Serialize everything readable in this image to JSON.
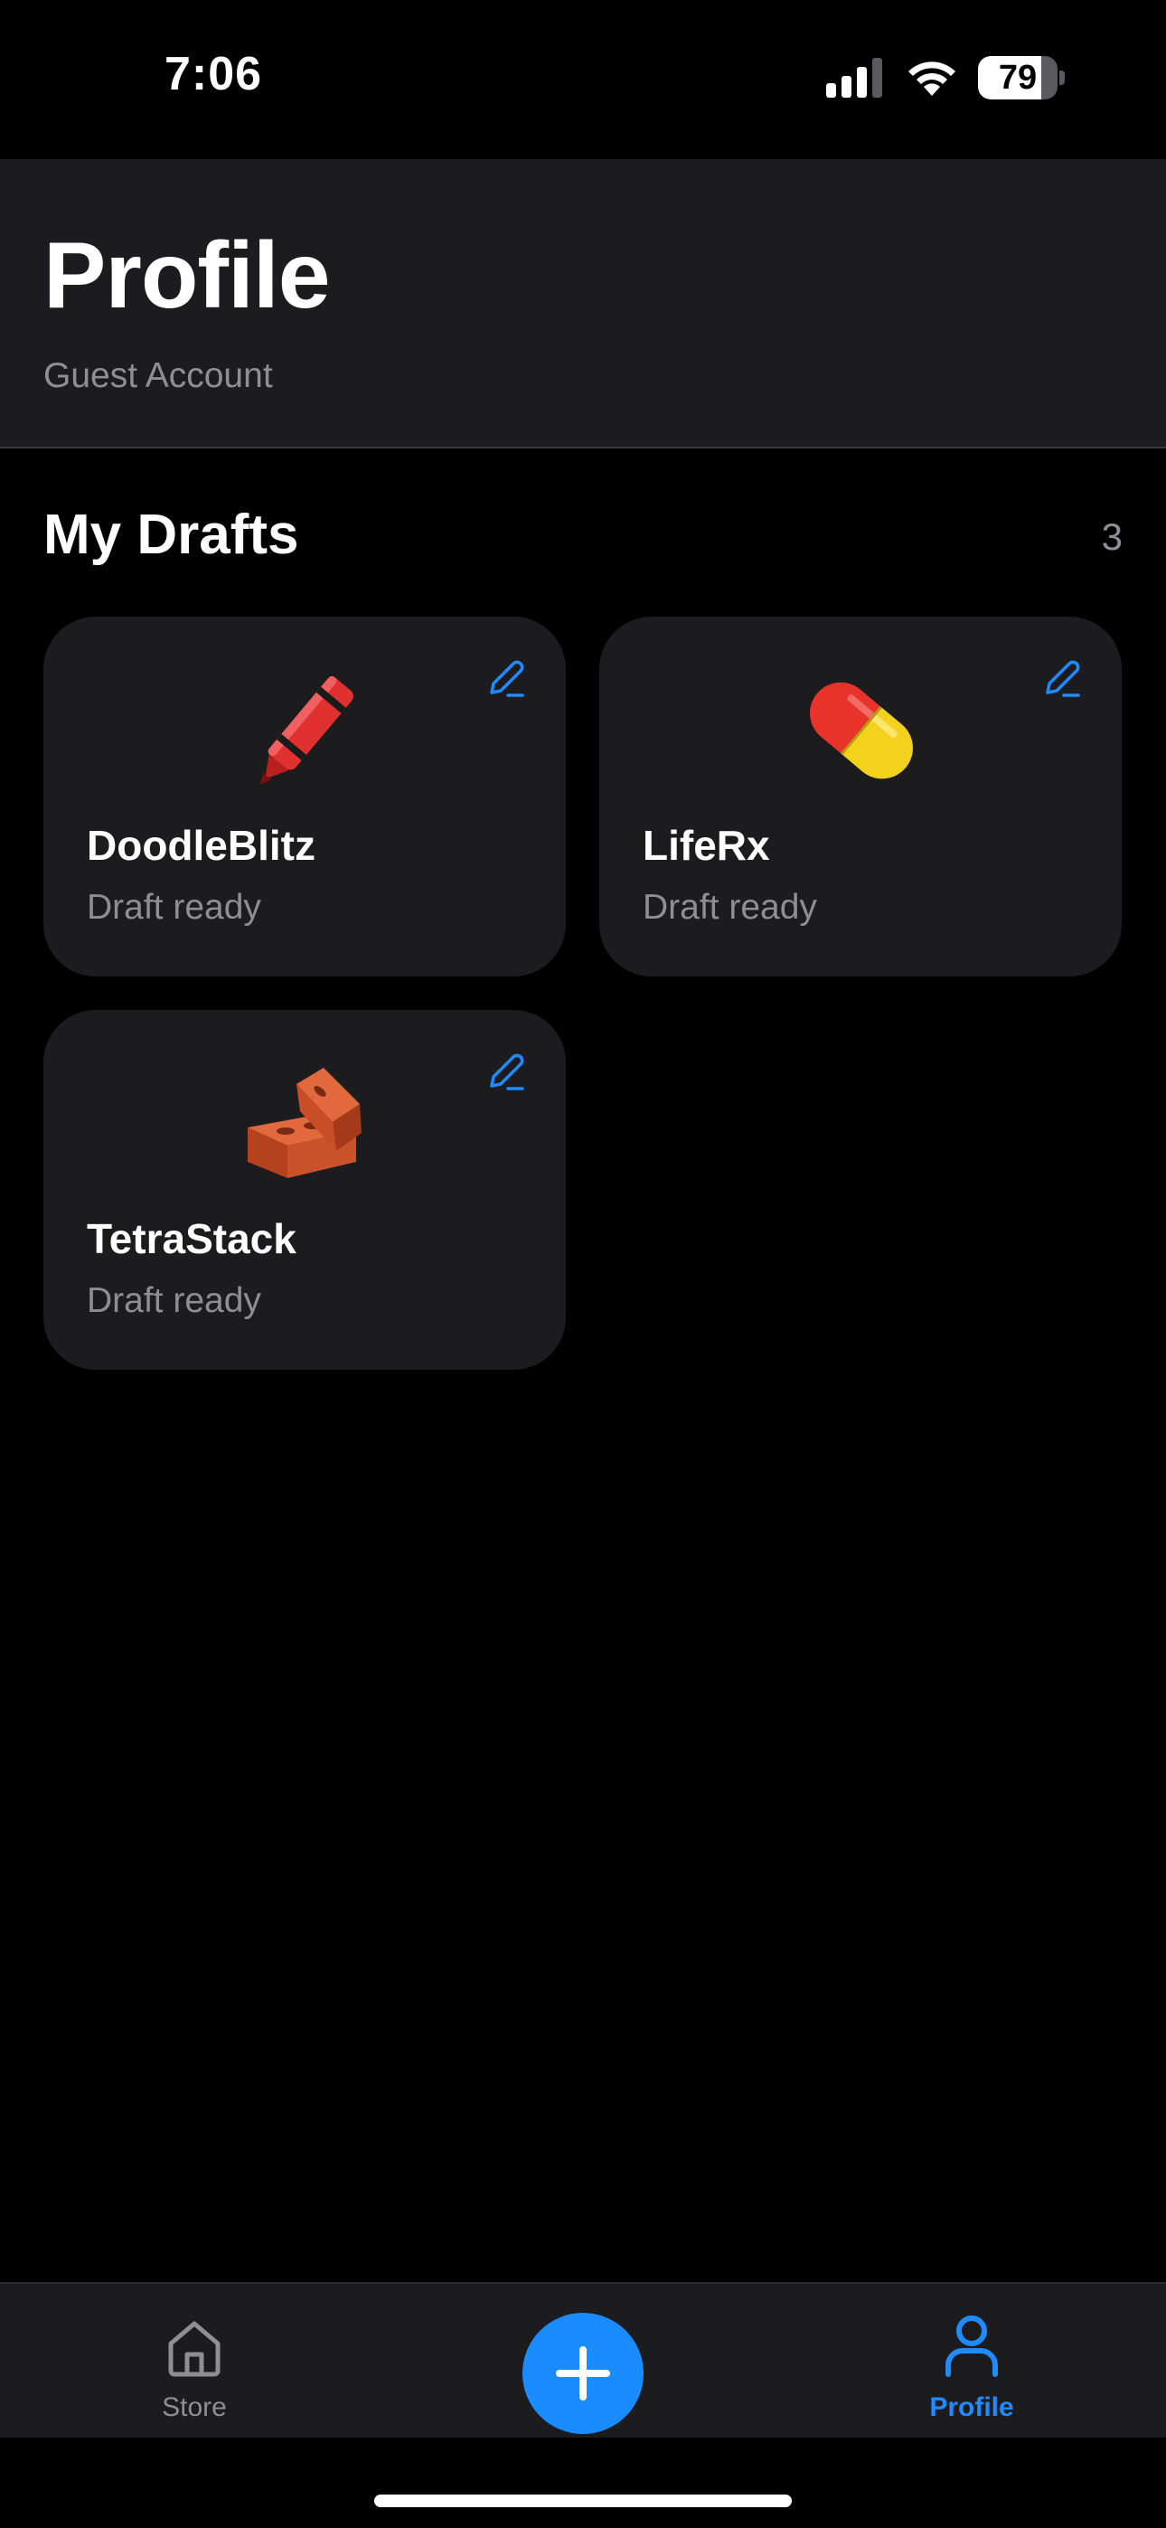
{
  "status_bar": {
    "time": "7:06",
    "battery_level": "79",
    "battery_fraction": 0.79
  },
  "header": {
    "title": "Profile",
    "subtitle": "Guest Account"
  },
  "drafts": {
    "title": "My Drafts",
    "count": "3",
    "items": [
      {
        "name": "DoodleBlitz",
        "status": "Draft ready",
        "icon": "crayon-icon"
      },
      {
        "name": "LifeRx",
        "status": "Draft ready",
        "icon": "pill-capsule-icon"
      },
      {
        "name": "TetraStack",
        "status": "Draft ready",
        "icon": "bricks-icon"
      }
    ]
  },
  "tab_bar": {
    "store_label": "Store",
    "profile_label": "Profile",
    "active_tab": "Profile"
  },
  "colors": {
    "accent": "#1a8cff",
    "card_background": "#1c1c1e",
    "secondary_text": "#8e8e93",
    "background": "#000000"
  }
}
